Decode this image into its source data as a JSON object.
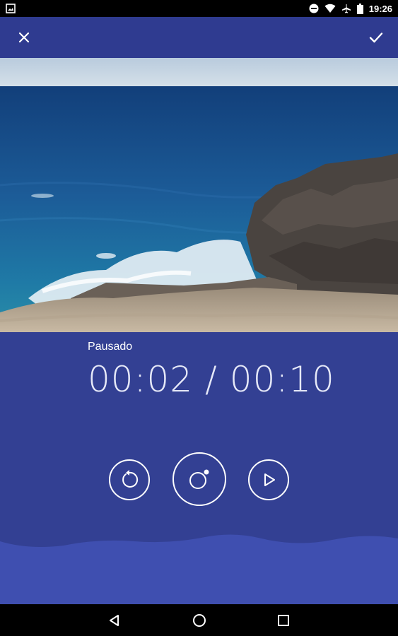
{
  "status_bar": {
    "time": "19:26",
    "icons": [
      "image-notification-icon",
      "do-not-disturb-icon",
      "wifi-icon",
      "airplane-mode-icon",
      "battery-icon"
    ]
  },
  "toolbar": {
    "close_icon": "close-icon",
    "confirm_icon": "check-icon"
  },
  "preview": {
    "description_icon": "photo-preview"
  },
  "recorder": {
    "state_label": "Pausado",
    "elapsed": "00:02",
    "separator": "/",
    "total": "00:10",
    "controls": [
      "restart-icon",
      "record-icon",
      "play-icon"
    ]
  },
  "navigation": {
    "items": [
      "back-icon",
      "home-icon",
      "recents-icon"
    ]
  },
  "colors": {
    "background": "#2f3d8f",
    "panel": "#334093",
    "wave": "#3f4fb0",
    "text": "#ffffff"
  }
}
